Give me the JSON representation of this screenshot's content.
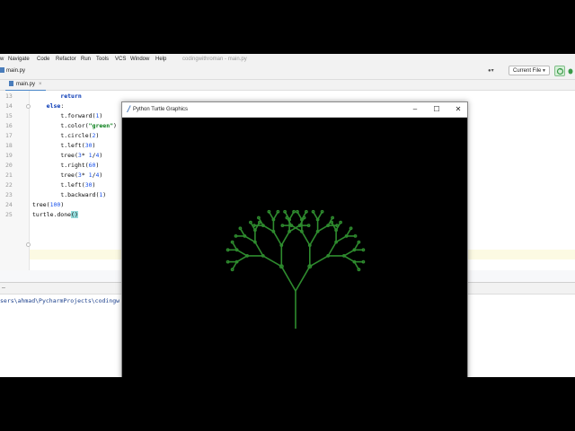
{
  "menu": {
    "items": [
      "w",
      "Navigate",
      "Code",
      "Refactor",
      "Run",
      "Tools",
      "VCS",
      "Window",
      "Help"
    ],
    "title": "codingwithroman - main.py"
  },
  "toolbar": {
    "breadcrumb": "main.py",
    "run_config": "Current File",
    "run_icon": "run-icon",
    "user_icon": "user-icon"
  },
  "tabs": [
    {
      "label": "main.py",
      "icon": "python-file-icon"
    }
  ],
  "editor": {
    "line_numbers": [
      "13",
      "14",
      "15",
      "16",
      "17",
      "18",
      "19",
      "20",
      "21",
      "22",
      "23",
      "24",
      "25"
    ],
    "lines": [
      {
        "indent": "        ",
        "parts": [
          {
            "t": "return",
            "c": "kw"
          }
        ]
      },
      {
        "indent": "    ",
        "parts": [
          {
            "t": "else",
            "c": "kw"
          },
          {
            "t": ":",
            "c": ""
          }
        ]
      },
      {
        "indent": "        ",
        "parts": [
          {
            "t": "t.forward(",
            "c": ""
          },
          {
            "t": "1",
            "c": "num"
          },
          {
            "t": ")",
            "c": ""
          }
        ]
      },
      {
        "indent": "        ",
        "parts": [
          {
            "t": "t.color(",
            "c": ""
          },
          {
            "t": "\"green\"",
            "c": "str"
          },
          {
            "t": ")",
            "c": ""
          }
        ]
      },
      {
        "indent": "        ",
        "parts": [
          {
            "t": "t.circle(",
            "c": ""
          },
          {
            "t": "2",
            "c": "num"
          },
          {
            "t": ")",
            "c": ""
          }
        ]
      },
      {
        "indent": "        ",
        "parts": [
          {
            "t": "t.left(",
            "c": ""
          },
          {
            "t": "30",
            "c": "num"
          },
          {
            "t": ")",
            "c": ""
          }
        ]
      },
      {
        "indent": "        ",
        "parts": [
          {
            "t": "tree(",
            "c": ""
          },
          {
            "t": "3",
            "c": "num"
          },
          {
            "t": "* ",
            "c": ""
          },
          {
            "t": "1",
            "c": "num"
          },
          {
            "t": "/",
            "c": ""
          },
          {
            "t": "4",
            "c": "num"
          },
          {
            "t": ")",
            "c": ""
          }
        ]
      },
      {
        "indent": "        ",
        "parts": [
          {
            "t": "t.right(",
            "c": ""
          },
          {
            "t": "60",
            "c": "num"
          },
          {
            "t": ")",
            "c": ""
          }
        ]
      },
      {
        "indent": "        ",
        "parts": [
          {
            "t": "tree(",
            "c": ""
          },
          {
            "t": "3",
            "c": "num"
          },
          {
            "t": "* ",
            "c": ""
          },
          {
            "t": "1",
            "c": "num"
          },
          {
            "t": "/",
            "c": ""
          },
          {
            "t": "4",
            "c": "num"
          },
          {
            "t": ")",
            "c": ""
          }
        ]
      },
      {
        "indent": "        ",
        "parts": [
          {
            "t": "t.left(",
            "c": ""
          },
          {
            "t": "30",
            "c": "num"
          },
          {
            "t": ")",
            "c": ""
          }
        ]
      },
      {
        "indent": "        ",
        "parts": [
          {
            "t": "t.backward(",
            "c": ""
          },
          {
            "t": "1",
            "c": "num"
          },
          {
            "t": ")",
            "c": ""
          }
        ]
      },
      {
        "indent": "",
        "parts": [
          {
            "t": "tree(",
            "c": ""
          },
          {
            "t": "100",
            "c": "num"
          },
          {
            "t": ")",
            "c": ""
          }
        ]
      },
      {
        "indent": "",
        "parts": [
          {
            "t": "turtle.done",
            "c": ""
          },
          {
            "t": "()",
            "c": "paren"
          }
        ]
      }
    ]
  },
  "run_panel": {
    "console_path": "sers\\ahmad\\PycharmProjects\\codingw"
  },
  "turtle_window": {
    "title": "Python Turtle Graphics",
    "min": "–",
    "max": "☐",
    "close": "✕",
    "colors": {
      "background": "#000000",
      "pen": "#2e8b2e"
    }
  }
}
